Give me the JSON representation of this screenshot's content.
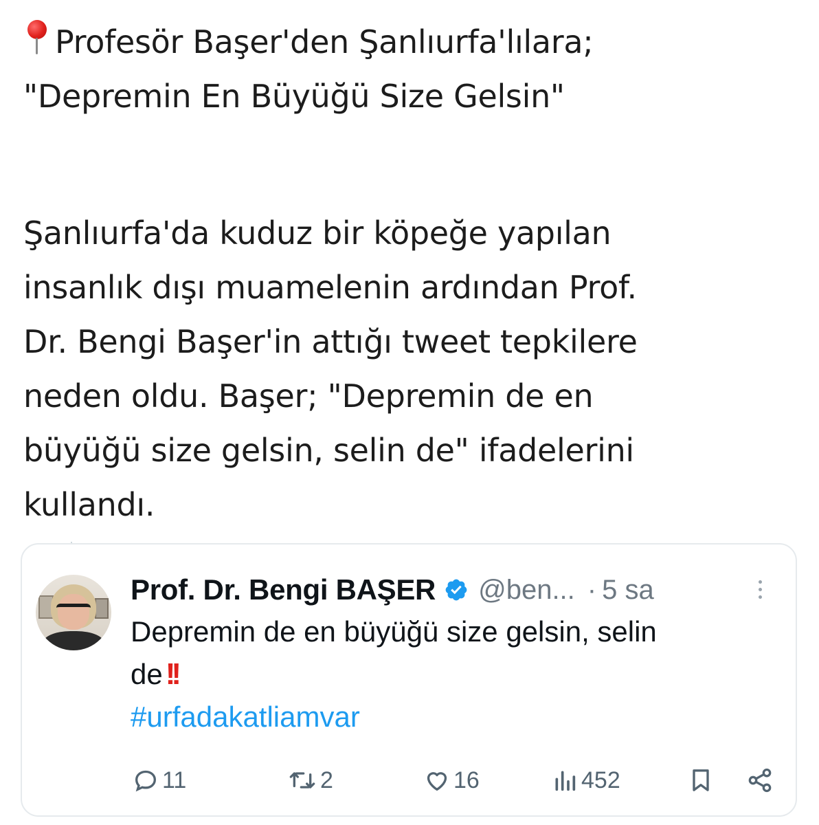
{
  "post": {
    "headline_line1": "Profesör Başer'den Şanlıurfa'lılara;",
    "headline_line2": "\"Depremin En Büyüğü Size Gelsin\"",
    "body_lines": [
      "Şanlıurfa'da kuduz bir köpeğe yapılan",
      "insanlık dışı muamelenin ardından Prof.",
      "Dr. Bengi Başer'in attığı tweet tepkilere",
      "neden oldu. Başer; \"Depremin de en",
      "büyüğü size gelsin, selin de\" ifadelerini",
      "kullandı."
    ],
    "pin_icon": "round-pushpin-icon"
  },
  "tweet": {
    "author_name": "Prof. Dr. Bengi BAŞER",
    "handle": "@ben...",
    "separator": "·",
    "time": "5 sa",
    "text_line1": "Depremin de en büyüğü size gelsin, selin",
    "text_line2": "de",
    "emoji": "!!",
    "hashtag": "#urfadakatliamvar",
    "verified_color": "#1d9bf0",
    "stats": {
      "replies": "11",
      "retweets": "2",
      "likes": "16",
      "views": "452"
    }
  },
  "colors": {
    "text": "#1c1c1c",
    "muted": "#536471",
    "accent": "#1d9bf0",
    "pin": "#e0211c"
  }
}
